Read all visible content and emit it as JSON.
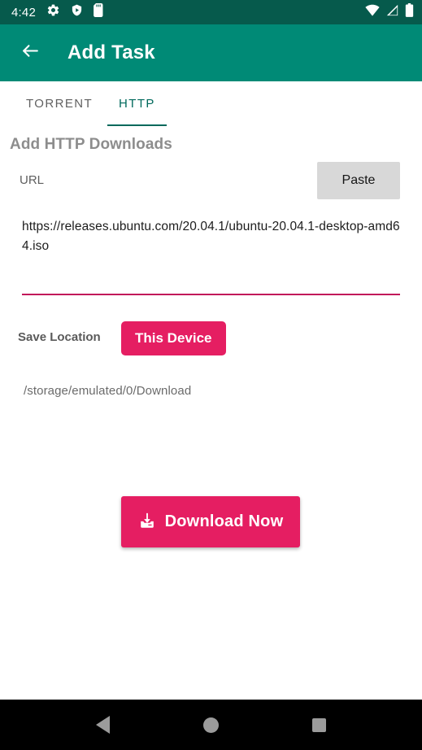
{
  "theme": {
    "statusbar_color": "#065a4c",
    "appbar_color": "#008a76",
    "accent_pink": "#e51e62",
    "tab_active_color": "#00695c",
    "underline_color": "#c2185b"
  },
  "statusbar": {
    "time": "4:42",
    "left_icons": [
      "gear-icon",
      "shield-play-icon",
      "sd-card-icon"
    ],
    "right_icons": [
      "wifi-icon",
      "cell-signal-icon",
      "battery-icon"
    ]
  },
  "appbar": {
    "back_icon": "arrow-left-icon",
    "title": "Add Task"
  },
  "tabs": [
    {
      "label": "TORRENT",
      "active": false
    },
    {
      "label": "HTTP",
      "active": true
    }
  ],
  "main": {
    "section_title": "Add HTTP Downloads",
    "url_label": "URL",
    "paste_label": "Paste",
    "url_value": "https://releases.ubuntu.com/20.04.1/ubuntu-20.04.1-desktop-amd64.iso",
    "url_placeholder": "URL",
    "save_location_label": "Save Location",
    "save_location_button": "This Device",
    "save_path": "/storage/emulated/0/Download",
    "download_button": "Download Now",
    "download_icon": "download-icon"
  },
  "navbar": {
    "back": "nav-back-icon",
    "home": "nav-home-icon",
    "recents": "nav-recents-icon"
  }
}
